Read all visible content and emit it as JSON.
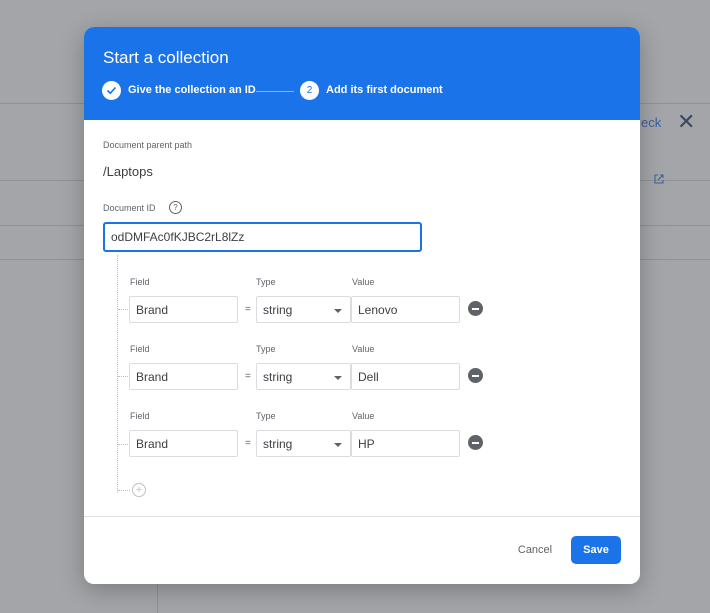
{
  "background": {
    "partial_link_text": "eck",
    "close_glyph": "✕"
  },
  "dialog": {
    "title": "Start a collection",
    "steps": [
      {
        "label": "Give the collection an ID",
        "status": "done"
      },
      {
        "number": "2",
        "label": "Add its first document",
        "status": "active"
      }
    ],
    "parent_path_label": "Document parent path",
    "parent_path_value": "/Laptops",
    "doc_id_label": "Document ID",
    "doc_id_help": "?",
    "doc_id_value": "odDMFAc0fKJBC2rL8lZz",
    "column_labels": {
      "field": "Field",
      "type": "Type",
      "value": "Value"
    },
    "equals_sign": "=",
    "fields": [
      {
        "field": "Brand",
        "type": "string",
        "value": "Lenovo"
      },
      {
        "field": "Brand",
        "type": "string",
        "value": "Dell"
      },
      {
        "field": "Brand",
        "type": "string",
        "value": "HP"
      }
    ],
    "add_field_glyph": "+",
    "cancel_label": "Cancel",
    "save_label": "Save"
  },
  "colors": {
    "accent": "#1a73e8",
    "overlay": "#a3a5a8",
    "text": "#3c4043",
    "muted": "#5f6368"
  },
  "icons": [
    "check-icon",
    "help-icon",
    "remove-icon",
    "add-icon",
    "close-icon",
    "external-link-icon"
  ]
}
